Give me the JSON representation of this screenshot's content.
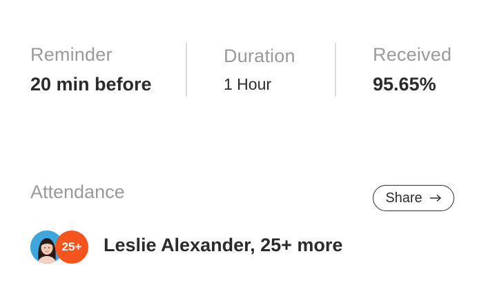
{
  "stats": [
    {
      "label": "Reminder",
      "value": "20 min before"
    },
    {
      "label": "Duration",
      "value": "1 Hour"
    },
    {
      "label": "Received",
      "value": "95.65%"
    }
  ],
  "attendance": {
    "title": "Attendance",
    "share_label": "Share",
    "more_badge": "25+",
    "summary": "Leslie Alexander, 25+ more"
  },
  "colors": {
    "more_badge": "#f5541d",
    "avatar_bg": "#3ea6dc"
  },
  "icons": {
    "share": "arrow-right-icon"
  }
}
